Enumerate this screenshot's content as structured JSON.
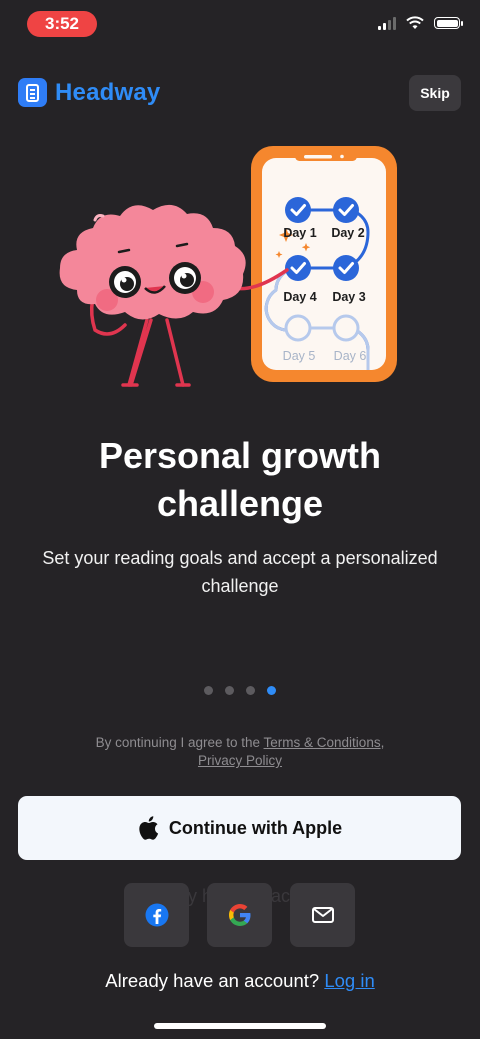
{
  "status": {
    "time": "3:52"
  },
  "header": {
    "brand": "Headway",
    "skip_label": "Skip"
  },
  "illustration": {
    "days": [
      "Day 1",
      "Day 2",
      "Day 4",
      "Day 3",
      "Day 5",
      "Day 6"
    ],
    "completed": [
      "Day 1",
      "Day 2",
      "Day 3",
      "Day 4"
    ]
  },
  "onboarding": {
    "title_line1": "Personal growth",
    "title_line2": "challenge",
    "subtitle_line1": "Set your reading goals and accept a personalized",
    "subtitle_line2": "challenge",
    "page_index": 4,
    "page_count": 4
  },
  "terms": {
    "prefix": "By continuing I agree to the ",
    "terms_link": "Terms & Conditions",
    "separator": ",",
    "privacy_link": "Privacy Policy"
  },
  "auth": {
    "apple_label": "Continue with Apple",
    "ghost_label": "Already have an account?",
    "social": [
      "facebook-icon",
      "google-icon",
      "mail-icon"
    ],
    "login_prompt": "Already have an account?",
    "login_link": "Log in"
  },
  "colors": {
    "accent": "#2f8cf7",
    "background": "#252326",
    "phone_frame": "#f5872e",
    "brain": "#f4879a"
  }
}
